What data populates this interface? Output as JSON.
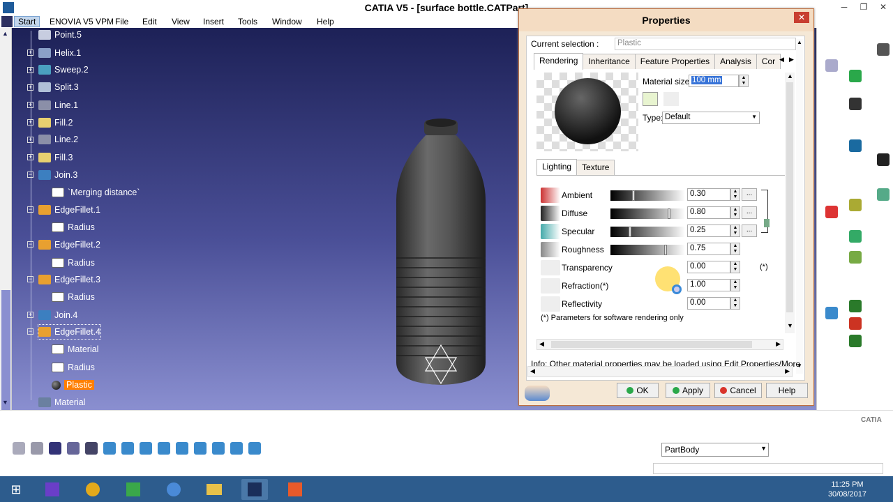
{
  "app": {
    "title": "CATIA V5 - [surface bottle.CATPart]",
    "window_controls": [
      "─",
      "❐",
      "✕"
    ]
  },
  "menubar": {
    "items": [
      "Start",
      "ENOVIA V5 VPM",
      "File",
      "Edit",
      "View",
      "Insert",
      "Tools",
      "Window",
      "Help"
    ]
  },
  "tree": {
    "items": [
      {
        "label": "Point.5",
        "icon": "point-icon"
      },
      {
        "label": "Helix.1",
        "icon": "helix-icon"
      },
      {
        "label": "Sweep.2",
        "icon": "sweep-icon"
      },
      {
        "label": "Split.3",
        "icon": "split-icon"
      },
      {
        "label": "Line.1",
        "icon": "line-icon"
      },
      {
        "label": "Fill.2",
        "icon": "fill-icon"
      },
      {
        "label": "Line.2",
        "icon": "line-icon"
      },
      {
        "label": "Fill.3",
        "icon": "fill-icon"
      },
      {
        "label": "Join.3",
        "icon": "join-icon"
      },
      {
        "label": "`Merging distance`",
        "icon": "parameter-icon"
      },
      {
        "label": "EdgeFillet.1",
        "icon": "edgefillet-icon"
      },
      {
        "label": "Radius",
        "icon": "parameter-icon"
      },
      {
        "label": "EdgeFillet.2",
        "icon": "edgefillet-icon"
      },
      {
        "label": "Radius",
        "icon": "parameter-icon"
      },
      {
        "label": "EdgeFillet.3",
        "icon": "edgefillet-icon"
      },
      {
        "label": "Radius",
        "icon": "parameter-icon"
      },
      {
        "label": "Join.4",
        "icon": "join-icon"
      },
      {
        "label": "EdgeFillet.4",
        "icon": "edgefillet-icon"
      },
      {
        "label": "Material",
        "icon": "parameter-icon"
      },
      {
        "label": "Radius",
        "icon": "parameter-icon"
      },
      {
        "label": "Plastic",
        "icon": "material-sphere-icon"
      },
      {
        "label": "Material",
        "icon": "material-icon"
      }
    ]
  },
  "dialog": {
    "title": "Properties",
    "current_selection_label": "Current selection :",
    "current_selection_value": "Plastic",
    "tabs": [
      "Rendering",
      "Inheritance",
      "Feature Properties",
      "Analysis",
      "Cor"
    ],
    "active_tab": "Rendering",
    "material_size_label": "Material size:",
    "material_size_value": "100 mm",
    "type_label": "Type:",
    "type_value": "Default",
    "subtabs": [
      "Lighting",
      "Texture"
    ],
    "params": [
      {
        "label": "Ambient",
        "value": "0.30",
        "level": 0.3
      },
      {
        "label": "Diffuse",
        "value": "0.80",
        "level": 0.8
      },
      {
        "label": "Specular",
        "value": "0.25",
        "level": 0.25
      },
      {
        "label": "Roughness",
        "value": "0.75",
        "level": 0.75
      },
      {
        "label": "Transparency",
        "value": "0.00"
      },
      {
        "label": "Refraction(*)",
        "value": "1.00"
      },
      {
        "label": "Reflectivity",
        "value": "0.00"
      }
    ],
    "note_star": "(*)",
    "footnote": "(*) Parameters for software rendering only",
    "info": "Info: Other material properties may be loaded using Edit Properties/More ite",
    "buttons": {
      "ok": "OK",
      "apply": "Apply",
      "cancel": "Cancel",
      "help": "Help"
    },
    "colors": {
      "accent_ok": "#2aa84a",
      "accent_cancel": "#d9342b",
      "accent_highlight": "#ff7f00"
    }
  },
  "bottom_toolbar": {
    "part_select": "PartBody"
  },
  "taskbar": {
    "time": "11:25 PM",
    "date": "30/08/2017"
  },
  "brand": {
    "logo_text": "CATIA"
  }
}
